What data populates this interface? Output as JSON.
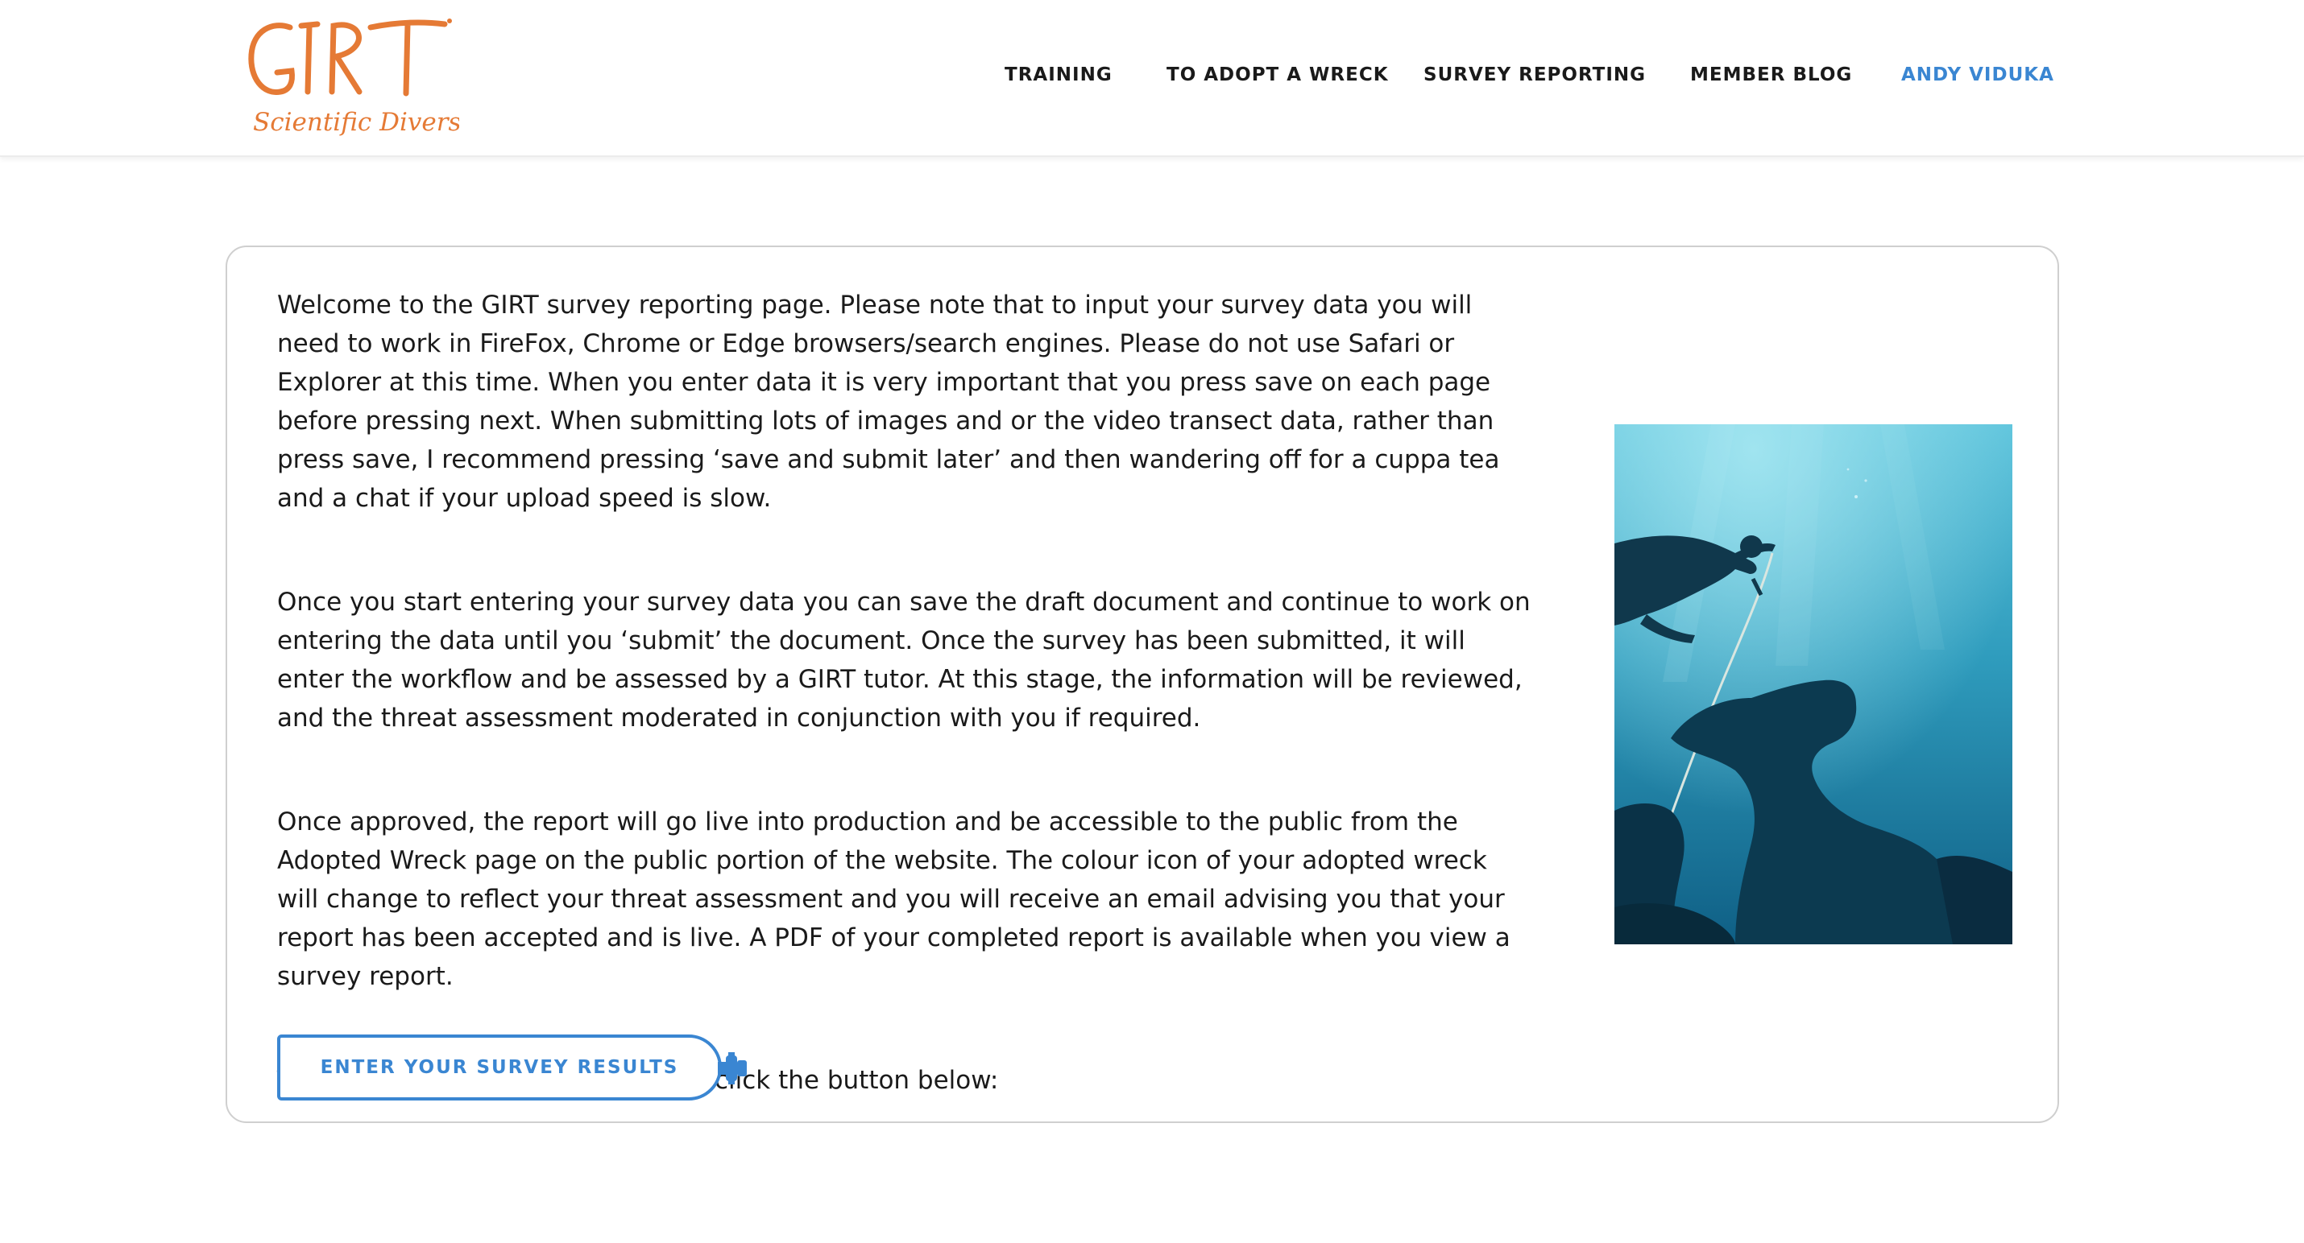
{
  "brand": {
    "logo_word": "GIRT",
    "logo_subtitle": "Scientific Divers",
    "logo_color": "#e57a35"
  },
  "nav": {
    "items": [
      {
        "label": "TRAINING"
      },
      {
        "label": "TO ADOPT A WRECK"
      },
      {
        "label": "SURVEY REPORTING"
      },
      {
        "label": "MEMBER BLOG"
      },
      {
        "label": "ANDY VIDUKA"
      }
    ],
    "active_color": "#3a86d2"
  },
  "content": {
    "paragraphs": [
      "Welcome to the GIRT survey reporting page. Please note that to input your survey data you will need to work in FireFox, Chrome or Edge browsers/search engines. Please do not use Safari or Explorer at this time. When you enter data it is very important that you press save on each page before pressing next. When submitting lots of images and or the video transect data, rather than press save, I recommend pressing ‘save and submit later’ and then wandering off for a cuppa tea and a chat if your upload speed is slow.",
      "Once you start entering your survey data you can save the draft document and continue to work on entering the data until you ‘submit’ the document. Once the survey has been submitted, it will enter the workflow and be assessed by a GIRT tutor. At this stage, the information will be reviewed, and the threat assessment moderated in conjunction with you if required.",
      "Once approved, the report will go live into production and be accessible to the public from the Adopted Wreck page on the public portion of the website. The colour icon of your adopted wreck will change to reflect your threat assessment and you will receive an email advising you that your report has been accepted and is live. A PDF of your completed report is available when you view a survey report.",
      "To commence submitting a survey click the button below:"
    ],
    "cta_label": "ENTER YOUR SURVEY RESULTS",
    "cta_color": "#3a86d2"
  }
}
